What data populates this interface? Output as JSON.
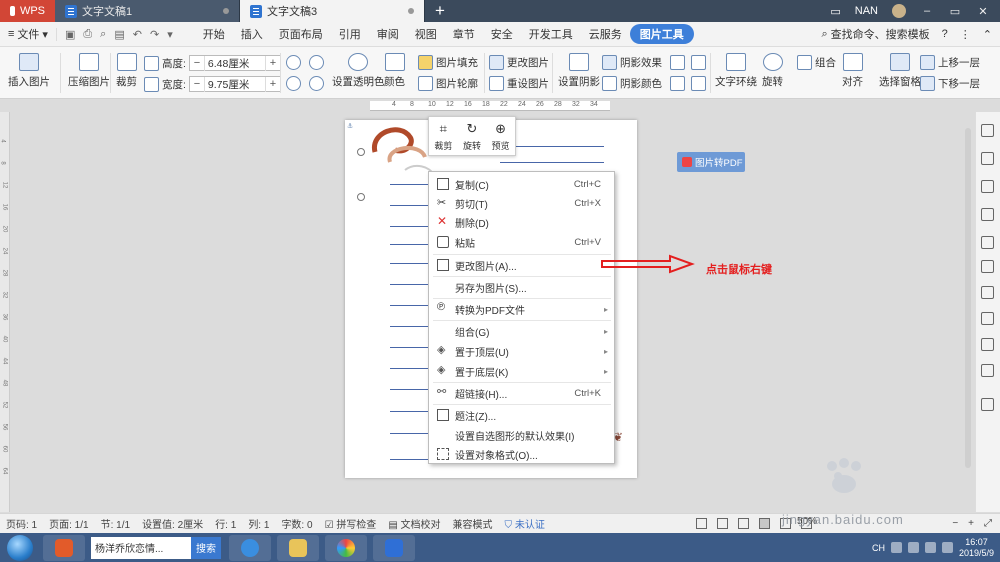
{
  "titlebar": {
    "app": "WPS",
    "tabs": [
      {
        "label": "文字文稿1",
        "active": false
      },
      {
        "label": "文字文稿3",
        "active": true
      }
    ],
    "add": "+",
    "user": "NAN"
  },
  "menubar": {
    "file": "文件",
    "items": [
      "开始",
      "插入",
      "页面布局",
      "引用",
      "审阅",
      "视图",
      "章节",
      "安全",
      "开发工具",
      "云服务",
      "图片工具"
    ],
    "active_item": "图片工具",
    "search": "查找命令、搜索模板",
    "help": "?"
  },
  "ribbon": {
    "insert_pic": "插入图片",
    "compress_pic": "压缩图片",
    "crop": "裁剪",
    "height_label": "高度:",
    "height_value": "6.48厘米",
    "width_label": "宽度:",
    "width_value": "9.75厘米",
    "set_transparent": "设置透明色",
    "color": "颜色",
    "pic_fill": "图片填充",
    "pic_outline": "图片轮廓",
    "change_pic": "更改图片",
    "reset_pic": "重设图片",
    "set_shadow": "设置阴影",
    "shadow_effect": "阴影效果",
    "shadow_color": "阴影颜色",
    "text_wrap": "文字环绕",
    "rotate": "旋转",
    "group": "组合",
    "align": "对齐",
    "selection_pane": "选择窗格",
    "bring_forward": "上移一层",
    "send_backward": "下移一层"
  },
  "ruler": {
    "h_ticks": [
      "4",
      "8",
      "10",
      "12",
      "16",
      "18",
      "22",
      "24",
      "26",
      "28",
      "32",
      "34"
    ],
    "v_ticks": [
      "4",
      "8",
      "12",
      "16",
      "20",
      "24",
      "28",
      "32",
      "36",
      "40",
      "44",
      "48",
      "52",
      "56",
      "60",
      "64"
    ]
  },
  "pic_toolbar": {
    "crop": "裁剪",
    "rotate": "旋转",
    "preview": "预览"
  },
  "context_menu": [
    {
      "label": "复制(C)",
      "shortcut": "Ctrl+C",
      "icon": "copy-icon",
      "arrow": false
    },
    {
      "label": "剪切(T)",
      "shortcut": "Ctrl+X",
      "icon": "scissors-icon",
      "arrow": false
    },
    {
      "label": "删除(D)",
      "shortcut": "",
      "icon": "delete-icon",
      "arrow": false
    },
    {
      "label": "粘贴",
      "shortcut": "Ctrl+V",
      "icon": "paste-icon",
      "arrow": false
    },
    {
      "label": "更改图片(A)...",
      "shortcut": "",
      "icon": "change-picture-icon",
      "arrow": false
    },
    {
      "label": "另存为图片(S)...",
      "shortcut": "",
      "icon": "",
      "arrow": false
    },
    {
      "label": "转换为PDF文件",
      "shortcut": "",
      "icon": "pdf-convert-icon",
      "arrow": true
    },
    {
      "label": "组合(G)",
      "shortcut": "",
      "icon": "",
      "arrow": true
    },
    {
      "label": "置于顶层(U)",
      "shortcut": "",
      "icon": "bring-to-front-icon",
      "arrow": true
    },
    {
      "label": "置于底层(K)",
      "shortcut": "",
      "icon": "send-to-back-icon",
      "arrow": true
    },
    {
      "label": "超链接(H)...",
      "shortcut": "Ctrl+K",
      "icon": "hyperlink-icon",
      "arrow": false
    },
    {
      "label": "题注(Z)...",
      "shortcut": "",
      "icon": "caption-icon",
      "arrow": false
    },
    {
      "label": "设置自选图形的默认效果(I)",
      "shortcut": "",
      "icon": "",
      "arrow": false
    },
    {
      "label": "设置对象格式(O)...",
      "shortcut": "",
      "icon": "format-object-icon",
      "arrow": false
    }
  ],
  "annotation": {
    "text": "点击鼠标右键",
    "color": "#e41f1f"
  },
  "pic_to_pdf": "图片转PDF",
  "statusbar": {
    "page_num": "页码: 1",
    "pages": "页面: 1/1",
    "section": "节: 1/1",
    "setting": "设置值: 2厘米",
    "row": "行: 1",
    "col": "列: 1",
    "words": "字数: 0",
    "spellcheck": "拼写检查",
    "proofread": "文档校对",
    "compat": "兼容模式",
    "auth": "未认证",
    "zoom": "50%"
  },
  "taskbar": {
    "search_value": "杨洋乔欣恋情...",
    "search_btn": "搜索",
    "lang": "CH",
    "time": "16:07",
    "date": "2019/5/9"
  },
  "watermark": {
    "site": "jingyan.baidu.com"
  },
  "colors": {
    "accent": "#3d7fd9",
    "wps_red": "#d24636",
    "titlebar": "#3b4a5c",
    "taskbar": "#3c5b87"
  }
}
